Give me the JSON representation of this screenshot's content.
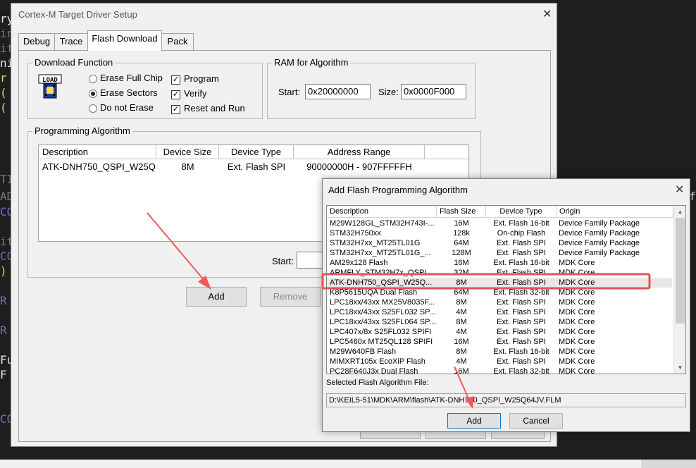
{
  "editor": {
    "fragments": [
      "ry",
      "ini",
      "it",
      "ni",
      "r",
      "(",
      "(",
      "TI",
      "AD",
      "CO",
      "it",
      "CO",
      ")",
      "R",
      "R",
      "Fu",
      "F",
      "CO",
      "f"
    ]
  },
  "main_dialog": {
    "title": "Cortex-M Target Driver Setup",
    "tabs": [
      "Debug",
      "Trace",
      "Flash Download",
      "Pack"
    ],
    "download_function": {
      "title": "Download Function",
      "load_icon_text": "LOAD",
      "erase_full_chip": "Erase Full Chip",
      "erase_sectors": "Erase Sectors",
      "do_not_erase": "Do not Erase",
      "program": "Program",
      "verify": "Verify",
      "reset_and_run": "Reset and Run"
    },
    "ram": {
      "title": "RAM for Algorithm",
      "start_label": "Start:",
      "start_value": "0x20000000",
      "size_label": "Size:",
      "size_value": "0x0000F000"
    },
    "programming_algorithm": {
      "title": "Programming Algorithm",
      "columns": [
        "Description",
        "Device Size",
        "Device Type",
        "Address Range"
      ],
      "rows": [
        [
          "ATK-DNH750_QSPI_W25Q...",
          "8M",
          "Ext. Flash SPI",
          "90000000H - 907FFFFFH"
        ]
      ],
      "start_label": "Start:"
    },
    "buttons": {
      "add": "Add",
      "remove": "Remove"
    }
  },
  "add_dialog": {
    "title": "Add Flash Programming Algorithm",
    "columns": [
      "Description",
      "Flash Size",
      "Device Type",
      "Origin"
    ],
    "rows": [
      [
        "M29W128GL_STM32H743I-...",
        "16M",
        "Ext. Flash 16-bit",
        "Device Family Package"
      ],
      [
        "STM32H750xx",
        "128k",
        "On-chip Flash",
        "Device Family Package"
      ],
      [
        "STM32H7xx_MT25TL01G",
        "64M",
        "Ext. Flash SPI",
        "Device Family Package"
      ],
      [
        "STM32H7xx_MT25TL01G_...",
        "128M",
        "Ext. Flash SPI",
        "Device Family Package"
      ],
      [
        "AM29x128 Flash",
        "16M",
        "Ext. Flash 16-bit",
        "MDK Core"
      ],
      [
        "ARMFLY_STM32H7x_QSPI",
        "32M",
        "Ext. Flash SPI",
        "MDK Core"
      ],
      [
        "ATK-DNH750_QSPI_W25Q...",
        "8M",
        "Ext. Flash SPI",
        "MDK Core"
      ],
      [
        "K8P5615UQA Dual Flash",
        "64M",
        "Ext. Flash 32-bit",
        "MDK Core"
      ],
      [
        "LPC18xx/43xx MX25V8035F...",
        "8M",
        "Ext. Flash SPI",
        "MDK Core"
      ],
      [
        "LPC18xx/43xx S25FL032 SP...",
        "4M",
        "Ext. Flash SPI",
        "MDK Core"
      ],
      [
        "LPC18xx/43xx S25FL064 SP...",
        "8M",
        "Ext. Flash SPI",
        "MDK Core"
      ],
      [
        "LPC407x/8x S25FL032 SPIFI",
        "4M",
        "Ext. Flash SPI",
        "MDK Core"
      ],
      [
        "LPC5460x MT25QL128 SPIFI",
        "16M",
        "Ext. Flash SPI",
        "MDK Core"
      ],
      [
        "M29W640FB Flash",
        "8M",
        "Ext. Flash 16-bit",
        "MDK Core"
      ],
      [
        "MIMXRT105x EcoXiP Flash",
        "4M",
        "Ext. Flash SPI",
        "MDK Core"
      ],
      [
        "PC28F640J3x Dual Flash",
        "16M",
        "Ext. Flash 32-bit",
        "MDK Core"
      ]
    ],
    "selected_index": 6,
    "selected_file_label": "Selected Flash Algorithm File:",
    "selected_file_path": "D:\\KEIL5-51\\MDK\\ARM\\flash\\ATK-DNH750_QSPI_W25Q64JV.FLM",
    "buttons": {
      "add": "Add",
      "cancel": "Cancel"
    }
  },
  "colors": {
    "highlight_box": "#e8505b",
    "arrow": "#f05a5a",
    "editor_bg": "#1e1e1e"
  }
}
